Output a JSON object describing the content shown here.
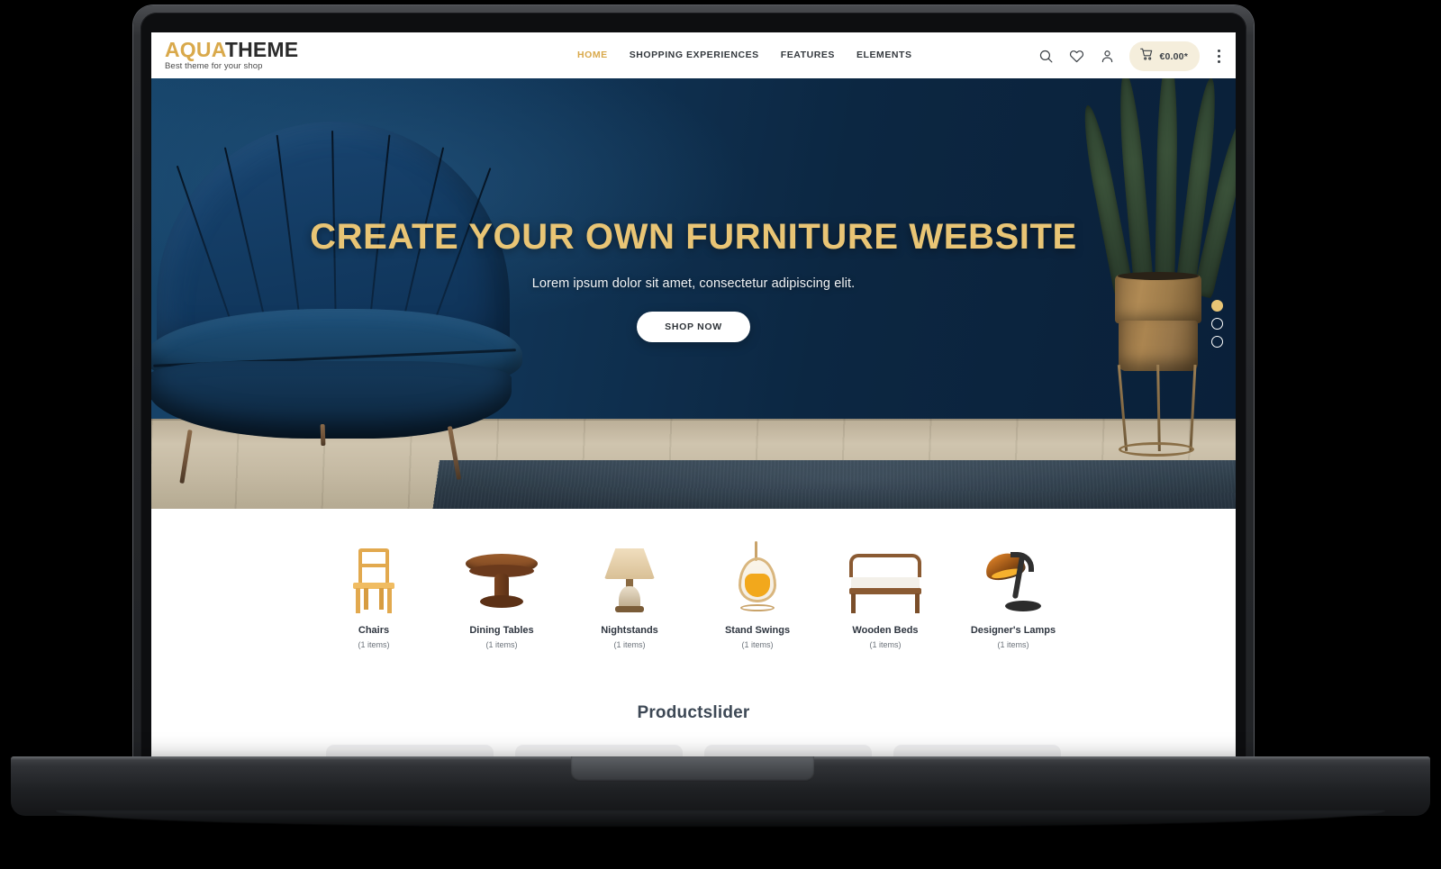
{
  "header": {
    "logo": {
      "part1": "AQUA",
      "part2": "THEME",
      "tagline": "Best theme for your shop"
    },
    "nav": [
      {
        "label": "HOME",
        "active": true
      },
      {
        "label": "SHOPPING EXPERIENCES",
        "active": false
      },
      {
        "label": "FEATURES",
        "active": false
      },
      {
        "label": "ELEMENTS",
        "active": false
      }
    ],
    "actions": {
      "search_icon": "search-icon",
      "wishlist_icon": "heart-icon",
      "account_icon": "user-icon",
      "cart_icon": "cart-icon",
      "cart_amount": "€0.00*",
      "menu_icon": "kebab-menu-icon"
    }
  },
  "hero": {
    "title": "CREATE YOUR OWN FURNITURE WEBSITE",
    "subtitle": "Lorem ipsum dolor sit amet, consectetur adipiscing elit.",
    "cta_label": "SHOP NOW",
    "slides": [
      {
        "index": 1,
        "active": true
      },
      {
        "index": 2,
        "active": false
      },
      {
        "index": 3,
        "active": false
      }
    ]
  },
  "categories": [
    {
      "name": "Chairs",
      "count": "(1 items)",
      "icon": "chair-icon"
    },
    {
      "name": "Dining Tables",
      "count": "(1 items)",
      "icon": "dining-table-icon"
    },
    {
      "name": "Nightstands",
      "count": "(1 items)",
      "icon": "table-lamp-icon"
    },
    {
      "name": "Stand Swings",
      "count": "(1 items)",
      "icon": "hanging-swing-icon"
    },
    {
      "name": "Wooden Beds",
      "count": "(1 items)",
      "icon": "bed-icon"
    },
    {
      "name": "Designer's Lamps",
      "count": "(1 items)",
      "icon": "desk-lamp-icon"
    }
  ],
  "productslider": {
    "title": "Productslider",
    "cards": [
      {
        "id": 1
      },
      {
        "id": 2
      },
      {
        "id": 3
      },
      {
        "id": 4
      }
    ]
  },
  "colors": {
    "brand_gold": "#D9A94B",
    "hero_gold": "#E9C575",
    "hero_navy": "#0E2A44",
    "cart_pill_bg": "#F5EEDC",
    "heading_slate": "#3D4855",
    "card_gray": "#F2F2F3"
  }
}
